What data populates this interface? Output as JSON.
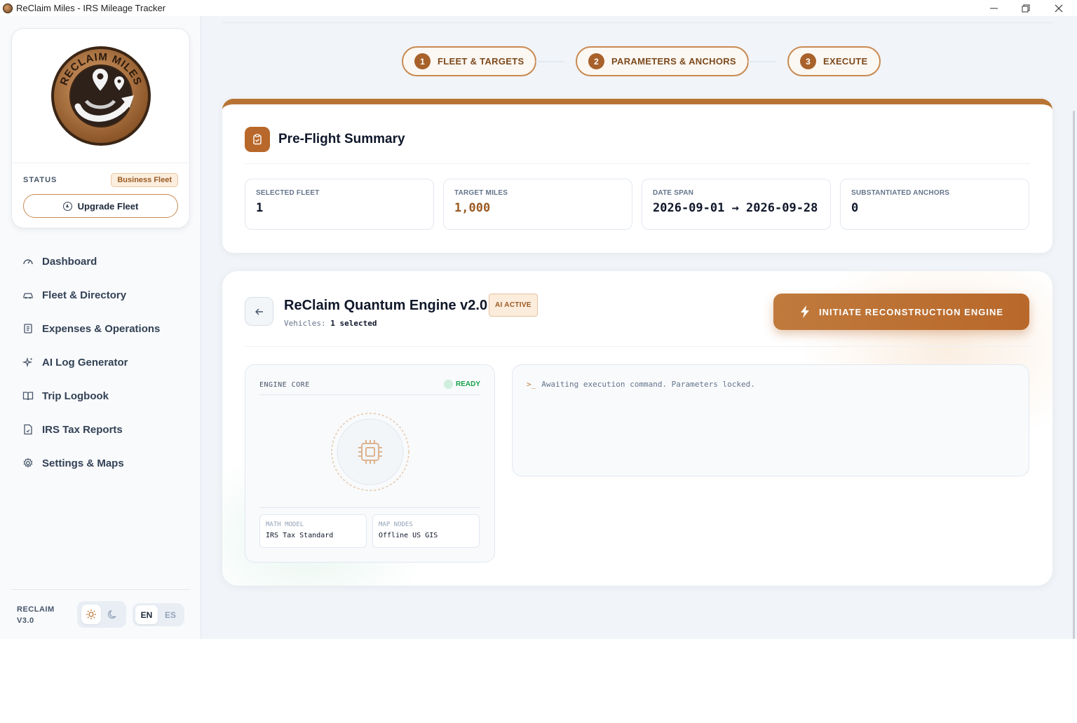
{
  "window": {
    "title": "ReClaim Miles - IRS Mileage Tracker"
  },
  "sidebar": {
    "logo_text": "RECLAIM MILES",
    "status_label": "STATUS",
    "status_badge": "Business Fleet",
    "upgrade_label": "Upgrade Fleet",
    "items": [
      {
        "label": "Dashboard",
        "icon": "gauge-icon"
      },
      {
        "label": "Fleet & Directory",
        "icon": "car-icon"
      },
      {
        "label": "Expenses & Operations",
        "icon": "receipt-icon"
      },
      {
        "label": "AI Log Generator",
        "icon": "sparkles-icon"
      },
      {
        "label": "Trip Logbook",
        "icon": "book-icon"
      },
      {
        "label": "IRS Tax Reports",
        "icon": "file-report-icon"
      },
      {
        "label": "Settings & Maps",
        "icon": "gear-icon"
      }
    ],
    "version_line1": "RECLAIM",
    "version_line2": "V3.0",
    "lang_en": "EN",
    "lang_es": "ES"
  },
  "stepper": [
    {
      "num": "1",
      "label": "FLEET & TARGETS"
    },
    {
      "num": "2",
      "label": "PARAMETERS & ANCHORS"
    },
    {
      "num": "3",
      "label": "EXECUTE"
    }
  ],
  "summary": {
    "title": "Pre-Flight Summary",
    "metrics": [
      {
        "label": "SELECTED FLEET",
        "value": "1"
      },
      {
        "label": "TARGET MILES",
        "value": "1,000"
      },
      {
        "label": "DATE SPAN",
        "value": "2026-09-01 → 2026-09-28"
      },
      {
        "label": "SUBSTANTIATED ANCHORS",
        "value": "0"
      }
    ]
  },
  "engine": {
    "title": "ReClaim Quantum Engine v2.0",
    "badge": "AI ACTIVE",
    "vehicles_label": "Vehicles:",
    "vehicles_value": "1 selected",
    "initiate_label": "INITIATE RECONSTRUCTION ENGINE",
    "core_label": "ENGINE CORE",
    "ready_label": "READY",
    "math_model_label": "MATH MODEL",
    "math_model_value": "IRS Tax Standard",
    "map_nodes_label": "MAP NODES",
    "map_nodes_value": "Offline US GIS",
    "console_prompt": ">_",
    "console_text": "Awaiting execution command. Parameters locked."
  },
  "colors": {
    "accent": "#b8682a",
    "accent_light": "#fbecdc",
    "ready": "#16a34a"
  }
}
